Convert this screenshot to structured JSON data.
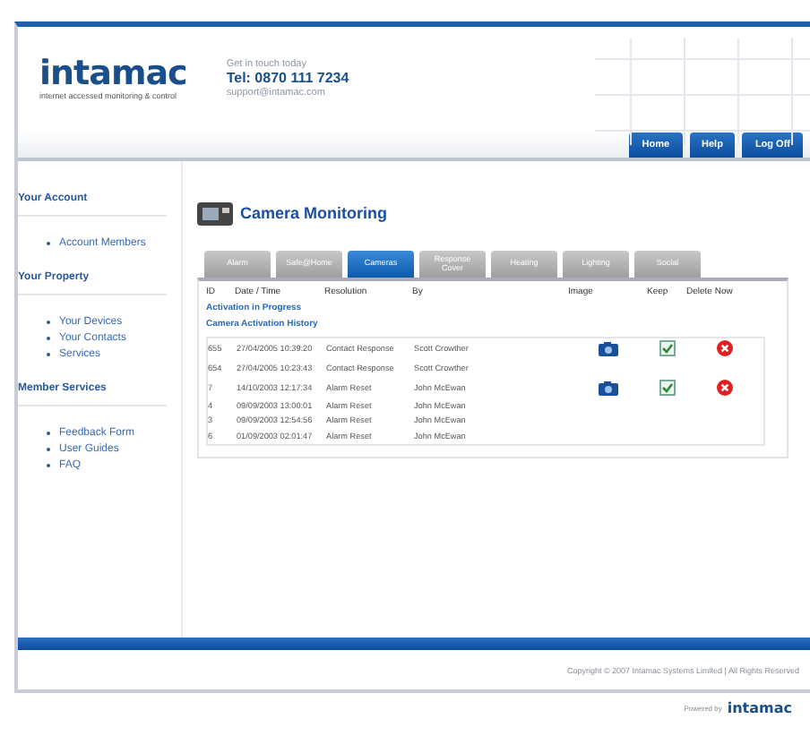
{
  "header": {
    "logo": "intamac",
    "tagline": "internet accessed monitoring & control",
    "contact_intro": "Get in touch today",
    "phone": "Tel: 0870 111 7234",
    "email": "support@intamac.com"
  },
  "nav_buttons": [
    "Home",
    "Help",
    "Log Off"
  ],
  "sidebar": [
    {
      "heading": "Your Account",
      "items": [
        "Account Members"
      ]
    },
    {
      "heading": "Your Property",
      "items": [
        "Your Devices",
        "Your Contacts",
        "Services"
      ]
    },
    {
      "heading": "Member Services",
      "items": [
        "Feedback Form",
        "User Guides",
        "FAQ"
      ]
    }
  ],
  "page_title": "Camera Monitoring",
  "tabs": [
    {
      "label": "Alarm",
      "selected": false
    },
    {
      "label": "Safe@Home",
      "selected": false
    },
    {
      "label": "Cameras",
      "selected": true
    },
    {
      "label": "Response Cover",
      "selected": false
    },
    {
      "label": "Heating",
      "selected": false
    },
    {
      "label": "Lighting",
      "selected": false
    },
    {
      "label": "Social",
      "selected": false
    }
  ],
  "table": {
    "columns": [
      "ID",
      "Date / Time",
      "Resolution",
      "By",
      "Image",
      "Keep",
      "Delete Now"
    ],
    "section_in_progress": "Activation in Progress",
    "section_history": "Camera Activation History",
    "rows": [
      {
        "id": "655",
        "datetime": "27/04/2005 10:39:20",
        "resolution": "Contact Response",
        "by": "Scott Crowther",
        "image": true,
        "keep": true,
        "delete": true
      },
      {
        "id": "654",
        "datetime": "27/04/2005 10:23:43",
        "resolution": "Contact Response",
        "by": "Scott Crowther",
        "image": false,
        "keep": false,
        "delete": false
      },
      {
        "id": "7",
        "datetime": "14/10/2003 12:17:34",
        "resolution": "Alarm Reset",
        "by": "John McEwan",
        "image": true,
        "keep": true,
        "delete": true
      },
      {
        "id": "4",
        "datetime": "09/09/2003 13:00:01",
        "resolution": "Alarm Reset",
        "by": "John McEwan",
        "image": false,
        "keep": false,
        "delete": false
      },
      {
        "id": "3",
        "datetime": "09/09/2003 12:54:56",
        "resolution": "Alarm Reset",
        "by": "John McEwan",
        "image": false,
        "keep": false,
        "delete": false
      },
      {
        "id": "6",
        "datetime": "01/09/2003 02:01:47",
        "resolution": "Alarm Reset",
        "by": "John McEwan",
        "image": false,
        "keep": false,
        "delete": false
      }
    ]
  },
  "copyright": "Copyright © 2007 Intamac Systems Limited | All Rights Reserved",
  "credit": {
    "text": "Powered by",
    "logo": "intamac"
  }
}
